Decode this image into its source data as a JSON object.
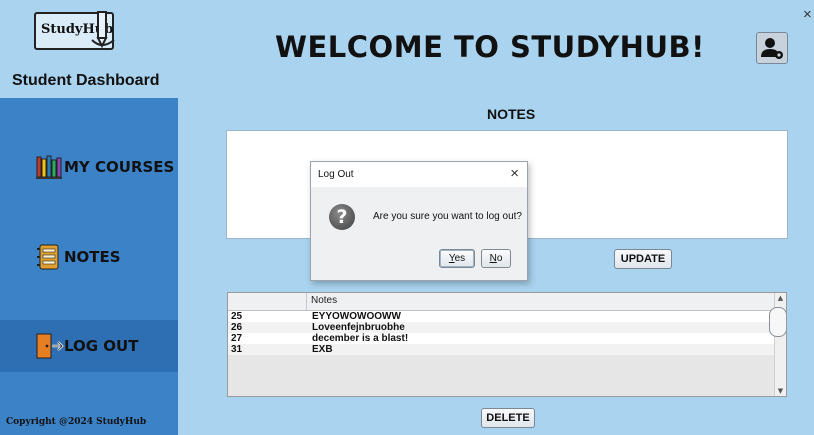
{
  "header": {
    "logo_text": "StudyHub",
    "dashboard_title": "Student Dashboard",
    "welcome": "WELCOME TO STUDYHUB!",
    "close_glyph": "×"
  },
  "sidebar": {
    "items": [
      {
        "label": "MY COURSES",
        "icon": "books-icon"
      },
      {
        "label": "NOTES",
        "icon": "notebook-icon"
      },
      {
        "label": "LOG OUT",
        "icon": "exit-door-icon"
      }
    ],
    "copyright": "Copyright @2024  StudyHub"
  },
  "notes": {
    "title": "NOTES",
    "update_label": "UPDATE",
    "delete_label": "DELETE",
    "table": {
      "columns": [
        "",
        "Notes"
      ],
      "rows": [
        {
          "id": "25",
          "note": "EYYOWOWOOWW"
        },
        {
          "id": "26",
          "note": "Loveenfejnbruobhe"
        },
        {
          "id": "27",
          "note": "december is a blast!"
        },
        {
          "id": "31",
          "note": "EXB"
        }
      ]
    }
  },
  "dialog": {
    "title": "Log Out",
    "close_glyph": "×",
    "message": "Are you sure you want to log out?",
    "yes_mnemonic": "Y",
    "yes_rest": "es",
    "no_mnemonic": "N",
    "no_rest": "o"
  },
  "colors": {
    "background": "#a9d3ee",
    "sidebar": "#3c82c7",
    "sidebar_selected": "#2e6fb4"
  }
}
